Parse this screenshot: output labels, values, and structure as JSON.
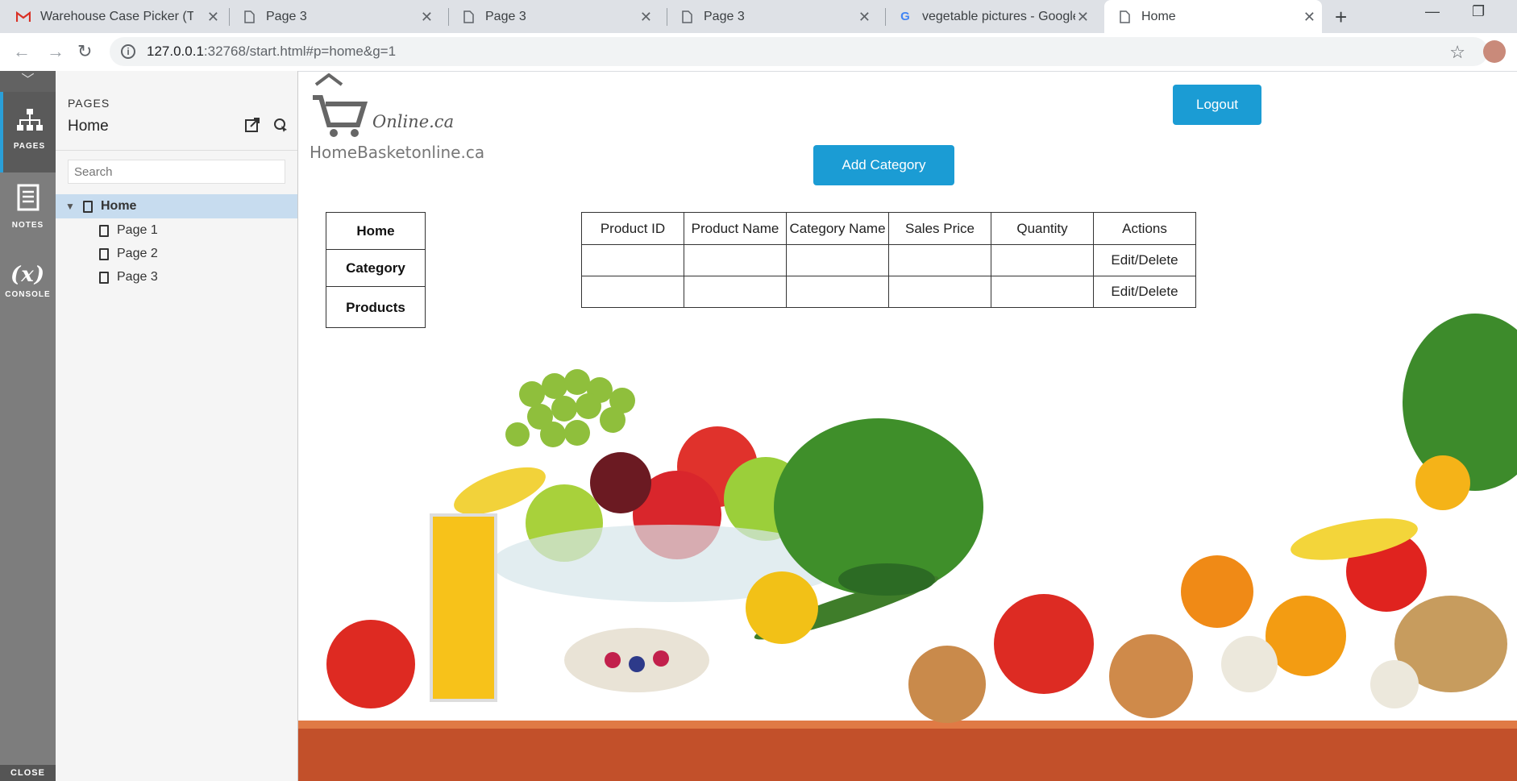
{
  "browser": {
    "tabs": [
      {
        "label": "Warehouse Case Picker (Thur",
        "icon": "gmail-icon"
      },
      {
        "label": "Page 3",
        "icon": "page-icon"
      },
      {
        "label": "Page 3",
        "icon": "page-icon"
      },
      {
        "label": "Page 3",
        "icon": "page-icon"
      },
      {
        "label": "vegetable pictures - Google S",
        "icon": "google-icon"
      },
      {
        "label": "Home",
        "icon": "page-icon",
        "active": true
      }
    ],
    "url_host": "127.0.0.1",
    "url_rest": ":32768/start.html#p=home&g=1"
  },
  "rail": {
    "pages_label": "PAGES",
    "notes_label": "NOTES",
    "console_label": "CONSOLE",
    "close_label": "CLOSE"
  },
  "pages_panel": {
    "heading": "PAGES",
    "title": "Home",
    "search_placeholder": "Search",
    "tree": [
      {
        "label": "Home",
        "level": 0
      },
      {
        "label": "Page 1",
        "level": 1
      },
      {
        "label": "Page 2",
        "level": 1
      },
      {
        "label": "Page 3",
        "level": 1
      }
    ]
  },
  "site": {
    "logo_online": "Online.ca",
    "logo_name": "HomeBasketonline.ca",
    "logout_label": "Logout",
    "add_category_label": "Add Category",
    "menu": [
      "Home",
      "Category",
      "Products"
    ],
    "table": {
      "headers": [
        "Product ID",
        "Product Name",
        "Category Name",
        "Sales Price",
        "Quantity",
        "Actions"
      ],
      "rows": [
        [
          "",
          "",
          "",
          "",
          "",
          "Edit/Delete"
        ],
        [
          "",
          "",
          "",
          "",
          "",
          "Edit/Delete"
        ]
      ]
    }
  },
  "colors": {
    "accent": "#1b9cd4",
    "rail": "#7d7d7d",
    "selected_row": "#c7dcef"
  }
}
